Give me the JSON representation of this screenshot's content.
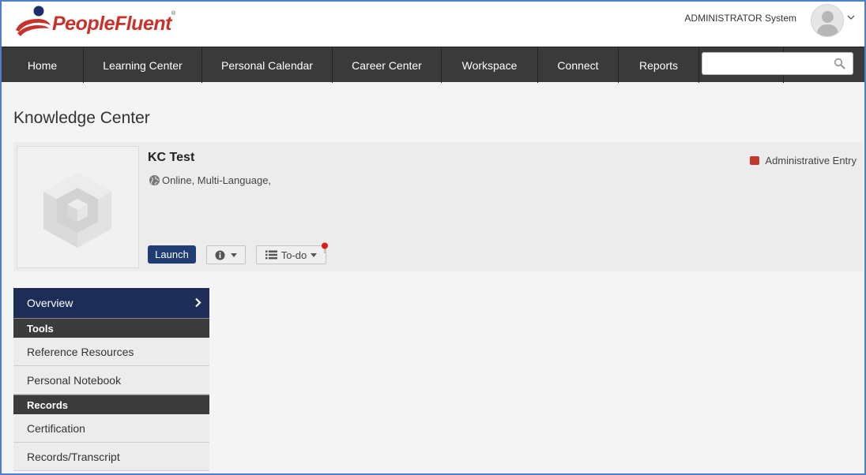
{
  "header": {
    "logo_text": "PeopleFluent",
    "logo_reg": "®",
    "user_name": "ADMINISTRATOR System",
    "avatar_icon": "user-avatar-icon"
  },
  "nav": {
    "items": [
      {
        "label": "Home"
      },
      {
        "label": "Learning Center"
      },
      {
        "label": "Personal Calendar"
      },
      {
        "label": "Career Center"
      },
      {
        "label": "Workspace"
      },
      {
        "label": "Connect"
      },
      {
        "label": "Reports"
      }
    ],
    "search": {
      "value": "",
      "placeholder": "",
      "icon": "search-icon"
    }
  },
  "page": {
    "title": "Knowledge Center"
  },
  "item": {
    "title": "KC Test",
    "meta": "Online, Multi-Language,",
    "admin_entry": "Administrative Entry",
    "admin_color": "#c0392b",
    "launch_label": "Launch",
    "todo_label": "To-do"
  },
  "side": {
    "active": "Overview",
    "sections": [
      {
        "title": "Tools",
        "items": [
          "Reference Resources",
          "Personal Notebook"
        ]
      },
      {
        "title": "Records",
        "items": [
          "Certification",
          "Records/Transcript"
        ]
      }
    ]
  },
  "colors": {
    "brand": "#c8322c",
    "nav_bg": "#3a3a3a",
    "active_bg": "#1c2e58",
    "launch_bg": "#1f3d73"
  }
}
